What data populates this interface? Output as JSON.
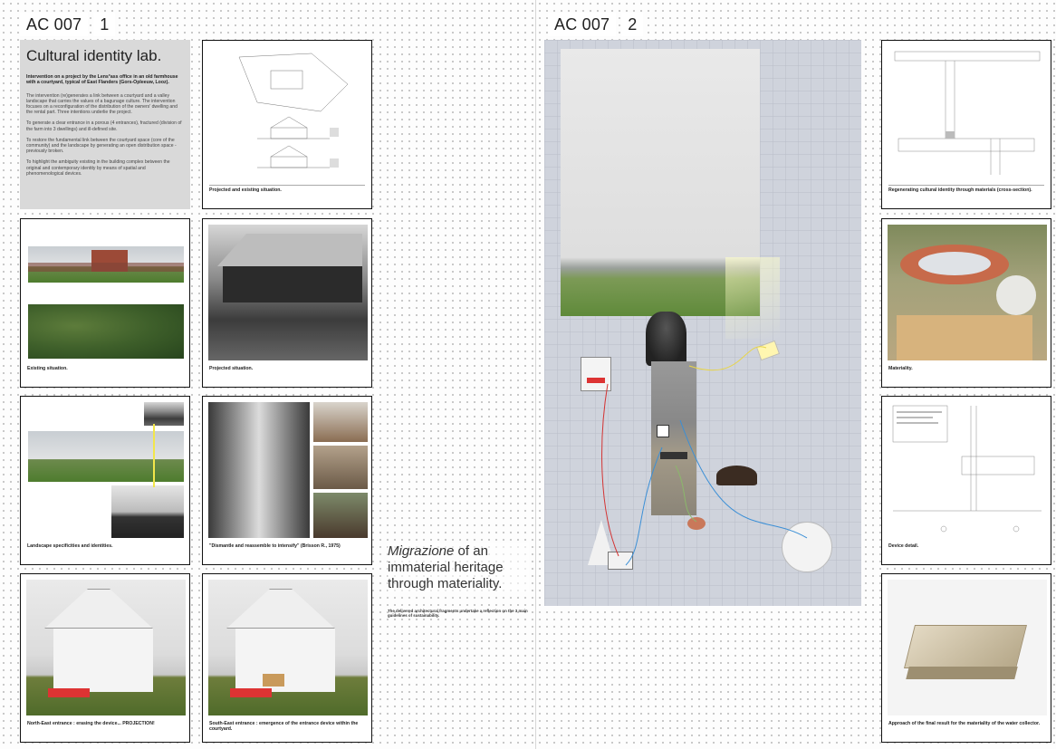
{
  "board1": {
    "header": {
      "code": "AC 007",
      "number": "1"
    },
    "intro": {
      "title": "Cultural identity lab.",
      "subtitle": "Intervention on a project by the Lens°ass office in an old farmhouse with a courtyard, typical of East Flanders (Gors-Opleeuw, Looz).",
      "paragraphs": [
        "The intervention (re)generates a link between a courtyard and a valley landscape that carries the values of a bagunage culture. The intervention focuses on a reconfiguration of the distribution of the owners' dwelling and the rental part. Three intentions underlie the project.",
        "To generate a clear entrance in a porous (4 entrances), fractured (division of the farm into 3 dwellings) and ill-defined site.",
        "To restore the fundamental link between the courtyard space (core of the community) and the landscape by generating an open distribution space - previously broken.",
        "To highlight the ambiguity existing in the building complex between the original and contemporary identity by means of spatial and phenomenological devices."
      ]
    },
    "cards": [
      {
        "caption": "Projected and existing situation."
      },
      {
        "caption": "Existing situation."
      },
      {
        "caption": "Projected situation."
      },
      {
        "caption": "Landscape specificities and identities."
      },
      {
        "caption": "\"Dismantle and reassemble to intensify\" (Brisson R., 1975)"
      },
      {
        "caption": "North-East entrance : erasing the device... PROJECTION!"
      },
      {
        "caption": "South-East entrance : emergence of the entrance device within the courtyard."
      }
    ],
    "migrazione": {
      "word": "Migrazione",
      "rest": "of an immaterial heritage through materiality.",
      "note": "The delivered architectural fragments undertake a reflection on the 3 main guidelines of sustainability."
    }
  },
  "board2": {
    "header": {
      "code": "AC 007",
      "number": "2"
    },
    "cards": [
      {
        "caption": "Regenerating cultural identity through materials (cross-section)."
      },
      {
        "caption": "Materiality."
      },
      {
        "caption": "Device detail."
      },
      {
        "caption": "Approach of the final result for the materiality of the water collector."
      }
    ]
  },
  "colors": {
    "grid": "#cfd3dc",
    "accent_red": "#d33333",
    "accent_blue": "#3b8fd6",
    "accent_yellow": "#f2e64b"
  }
}
